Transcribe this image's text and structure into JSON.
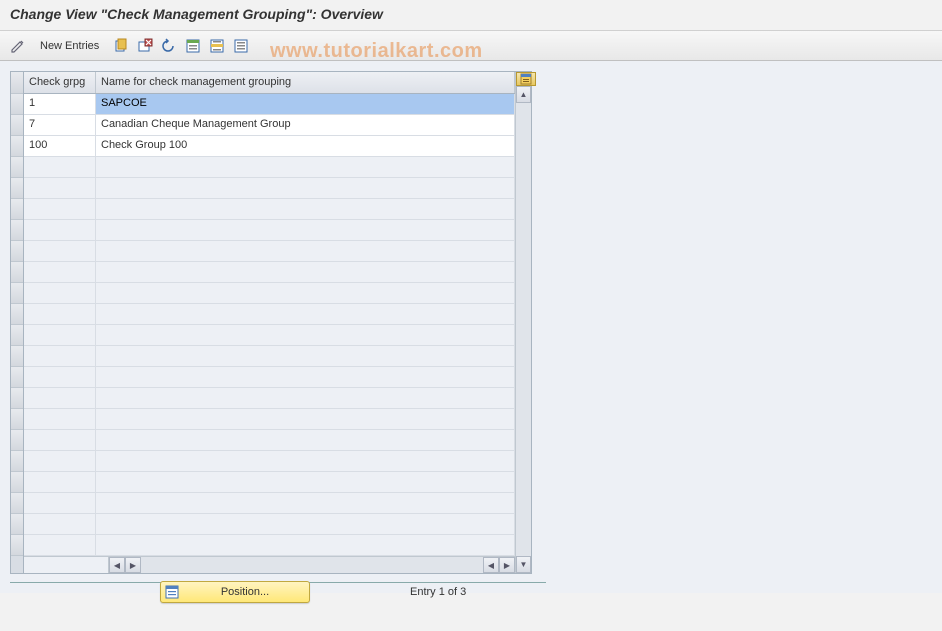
{
  "title": "Change View \"Check Management Grouping\": Overview",
  "watermark": "www.tutorialkart.com",
  "toolbar": {
    "new_entries_label": "New Entries"
  },
  "table": {
    "headers": {
      "col1": "Check grpg",
      "col2": "Name for check management grouping"
    },
    "rows": [
      {
        "code": "1",
        "name": "SAPCOE",
        "selected": true
      },
      {
        "code": "7",
        "name": "Canadian Cheque Management Group",
        "selected": false
      },
      {
        "code": "100",
        "name": "Check Group 100",
        "selected": false
      }
    ],
    "empty_row_count": 19
  },
  "footer": {
    "position_label": "Position...",
    "entry_status": "Entry 1 of 3"
  }
}
